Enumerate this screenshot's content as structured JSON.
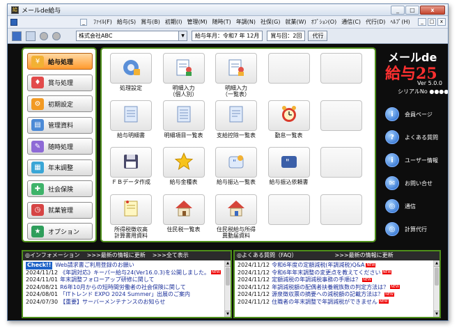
{
  "window": {
    "title": "メールde給与",
    "btn_min": "_",
    "btn_max": "□",
    "btn_close": "x"
  },
  "menu": {
    "items": [
      "ﾌｧｲﾙ(F)",
      "給与(S)",
      "賞与(B)",
      "初期(I)",
      "管理(M)",
      "随時(T)",
      "年調(N)",
      "社保(G)",
      "就業(W)",
      "ｵﾌﾟｼｮﾝ(O)",
      "通信(C)",
      "代行(D)",
      "ﾍﾙﾌﾟ(H)"
    ]
  },
  "toolbar": {
    "company": "株式会社ABC",
    "pay_month_label": "給与年月：",
    "pay_month": "令和7 年 12月",
    "bonus_label": "賞与回：",
    "bonus_value": "2回",
    "proxy_btn": "代行"
  },
  "left_tabs": [
    {
      "label": "給与処理",
      "icon": "payroll-icon",
      "active": true
    },
    {
      "label": "賞与処理",
      "icon": "bonus-icon",
      "active": false
    },
    {
      "label": "初期設定",
      "icon": "settings-icon",
      "active": false
    },
    {
      "label": "管理資料",
      "icon": "report-icon",
      "active": false
    },
    {
      "label": "随時処理",
      "icon": "occasional-icon",
      "active": false
    },
    {
      "label": "年末調整",
      "icon": "calendar-icon",
      "active": false
    },
    {
      "label": "社会保険",
      "icon": "insurance-icon",
      "active": false
    },
    {
      "label": "就業管理",
      "icon": "clock-icon",
      "active": false
    },
    {
      "label": "オプション",
      "icon": "option-icon",
      "active": false
    }
  ],
  "grid": {
    "row1": [
      {
        "caption": "処理設定",
        "icon": "process-settings-icon"
      },
      {
        "caption": "明細入力\n（個人別）",
        "icon": "edit-individual-icon"
      },
      {
        "caption": "明細入力\n（一覧表）",
        "icon": "edit-list-icon"
      },
      {
        "caption": "",
        "icon": ""
      },
      {
        "caption": "",
        "icon": ""
      }
    ],
    "row2": [
      {
        "caption": "給与明細書",
        "icon": "payslip-icon"
      },
      {
        "caption": "明細項目一覧表",
        "icon": "item-list-icon"
      },
      {
        "caption": "支給控除一覧表",
        "icon": "deduction-list-icon"
      },
      {
        "caption": "勤怠一覧表",
        "icon": "alarm-clock-icon"
      },
      {
        "caption": "",
        "icon": ""
      }
    ],
    "row3": [
      {
        "caption": "ＦＢデータ作成",
        "icon": "floppy-icon"
      },
      {
        "caption": "給与金種表",
        "icon": "star-icon"
      },
      {
        "caption": "給与振込一覧表",
        "icon": "transfer-list-icon"
      },
      {
        "caption": "給与振込依頼書",
        "icon": "transfer-request-icon"
      },
      {
        "caption": "",
        "icon": ""
      }
    ],
    "row4": [
      {
        "caption": "所得税徴収高\n計算書用資料",
        "icon": "tax-memo-icon"
      },
      {
        "caption": "住民税一覧表",
        "icon": "house-icon"
      },
      {
        "caption": "住民税給与所得\n異動届資料",
        "icon": "house-change-icon"
      },
      {
        "caption": "",
        "icon": ""
      },
      {
        "caption": "",
        "icon": ""
      }
    ]
  },
  "brand": {
    "line1": "メールde",
    "line2": "給与",
    "num": "25",
    "ver": "Ver 5.0.0",
    "serial": "シリアルNo ●●●●"
  },
  "right_links": [
    {
      "label": "会員ページ",
      "icon": "member-icon",
      "glyph": "i"
    },
    {
      "label": "よくある質問",
      "icon": "faq-icon",
      "glyph": "?"
    },
    {
      "label": "ユーザー情報",
      "icon": "user-info-icon",
      "glyph": "i"
    },
    {
      "label": "お問い合せ",
      "icon": "mail-icon",
      "glyph": "✉"
    },
    {
      "label": "通信",
      "icon": "globe-icon",
      "glyph": "◎"
    },
    {
      "label": "計算代行",
      "icon": "calc-service-icon",
      "glyph": "◎"
    }
  ],
  "info": {
    "h1": "◎インフォメーション",
    "h2": ">>>最新の情報に更新",
    "h3": ">>>全て表示",
    "checkit": "Check!!",
    "rows": [
      {
        "date": "",
        "text": "Web請求書ご利用登録のお願い",
        "new": false
      },
      {
        "date": "2024/11/12",
        "text": "《年調対応》キーパー給与24(Ver16.0.3)を公開しました。",
        "new": true
      },
      {
        "date": "2024/11/01",
        "text": "年末調整フォローアップ研修に関して",
        "new": false
      },
      {
        "date": "2024/08/21",
        "text": "R6年10月からの短時間労働者の社会保険に関して",
        "new": false
      },
      {
        "date": "2024/08/01",
        "text": "「ITトレンド EXPO 2024 Summer」出展のご案内",
        "new": false
      },
      {
        "date": "2024/07/30",
        "text": "【重要】サーバーメンテナンスのお知らせ",
        "new": false
      }
    ]
  },
  "faq": {
    "h1": "◎よくある質問（FAQ）",
    "h2": ">>>最新の情報に更新",
    "rows": [
      {
        "date": "2024/11/12",
        "text": "令和6年度の定額減税(年調減税)Q&A",
        "new": true
      },
      {
        "date": "2024/11/12",
        "text": "令和6年年末調整の変更点を教えてください",
        "new": true
      },
      {
        "date": "2024/11/12",
        "text": "定額減税の年調減税事務の手順は？",
        "new": true
      },
      {
        "date": "2024/11/12",
        "text": "年調減税額の配偶者扶養親族数の判定方法は？",
        "new": true
      },
      {
        "date": "2024/11/12",
        "text": "源泉徴収票の摘要への減税額の記載方法は？",
        "new": true
      },
      {
        "date": "2024/11/12",
        "text": "住職者の年末調整で年調減税ができません",
        "new": true
      }
    ]
  }
}
